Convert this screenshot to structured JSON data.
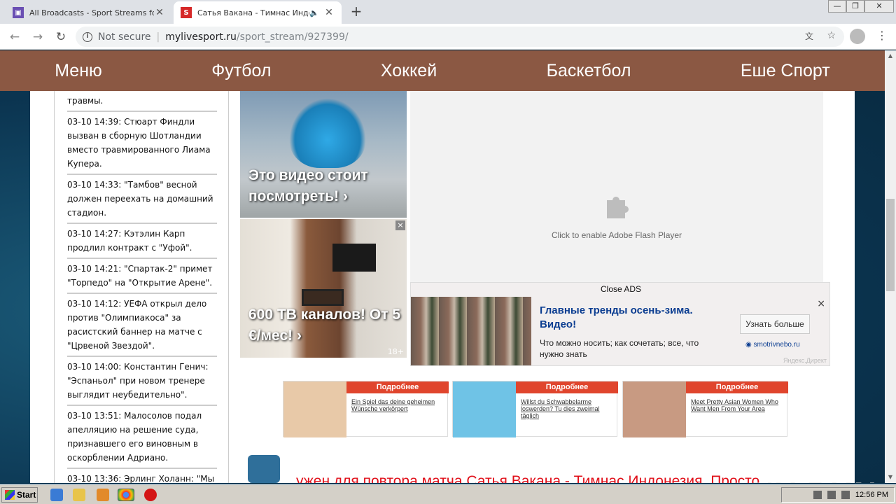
{
  "browser": {
    "tabs": [
      {
        "title": "All Broadcasts - Sport Streams for ea"
      },
      {
        "title": "Сатья Вакана - Тимнас Индоне"
      }
    ],
    "new_tab": "+",
    "not_secure": "Not secure",
    "url_host": "mylivesport.ru",
    "url_path": "/sport_stream/927399/"
  },
  "site_nav": [
    "Меню",
    "Футбол",
    "Хоккей",
    "Баскетбол",
    "Еше Спорт"
  ],
  "news": [
    {
      "time": "",
      "text": "травмы."
    },
    {
      "time": "03-10 14:39:",
      "text": "Стюарт Финдли вызван в сборную Шотландии вместо травмированного Лиама Купера."
    },
    {
      "time": "03-10 14:33:",
      "text": "\"Тамбов\" весной должен переехать на домашний стадион."
    },
    {
      "time": "03-10 14:27:",
      "text": "Кэтэлин Карп продлил контракт с \"Уфой\"."
    },
    {
      "time": "03-10 14:21:",
      "text": "\"Спартак-2\" примет \"Торпедо\" на \"Открытие Арене\"."
    },
    {
      "time": "03-10 14:12:",
      "text": "УЕФА открыл дело против \"Олимпиакоса\" за расистский баннер на матче с \"Црвеной Звездой\"."
    },
    {
      "time": "03-10 14:00:",
      "text": "Константин Генич: \"Эспаньол\" при новом тренере выглядит неубедительно\"."
    },
    {
      "time": "03-10 13:51:",
      "text": "Малосолов подал апелляцию на решение суда, признавшего его виновным в оскорблении Адриано."
    },
    {
      "time": "03-10 13:36:",
      "text": "Эрлинг Холанн: \"Мы доказали, что можем бороться на самом высоком уровне\""
    }
  ],
  "ads": {
    "ad1_text": "Это видео стоит посмотреть! ›",
    "ad2_text": "600 ТВ каналов! От 5 €/мес! ›",
    "ad2_age": "18+",
    "ad_close": "×"
  },
  "player": {
    "flash_text": "Click to enable Adobe Flash Player"
  },
  "yandex_ad": {
    "close_ads": "Close ADS",
    "headline": "Главные тренды осень-зима. Видео!",
    "desc": "Что можно носить; как сочетать; все, что нужно знать",
    "button": "Узнать больше",
    "domain": "smotrivnebo.ru",
    "label": "Яндекс.Директ",
    "close": "×"
  },
  "cards": [
    {
      "more": "Подробнее",
      "text": "Ein Spiel das deine geheimen Wünsche verkörpert",
      "color": "#e8c9a8"
    },
    {
      "more": "Подробнее",
      "text": "Willst du Schwabbelarme loswerden? Tu dies zweimal täglich",
      "color": "#6fc3e6"
    },
    {
      "more": "Подробнее",
      "text": "Meet Pretty Asian Women Who Want Men From Your Area",
      "color": "#c89a82"
    }
  ],
  "bottom_title": "ужен для повтора матча Сатья Вакана - Тимнас Индонезия. Просто",
  "watermark": "ANY RUN",
  "taskbar": {
    "start": "Start",
    "clock": "12:56 PM"
  }
}
